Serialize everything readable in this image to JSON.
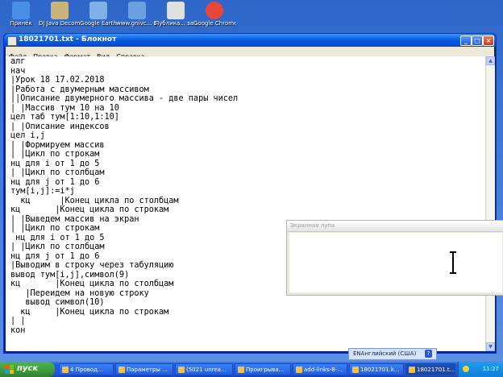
{
  "desktop_icons": [
    {
      "label": "Принёк",
      "color": "#4a8fe7"
    },
    {
      "label": "DJ Java Decompil",
      "color": "#c9b37a"
    },
    {
      "label": "Google Earth",
      "color": "#7fb0e8"
    },
    {
      "label": "www.gnivc... Браузер...",
      "color": "#6aa0e0"
    },
    {
      "label": "Публика... за 2011 го...",
      "color": "#e0e0e0"
    },
    {
      "label": "Google Chrome",
      "color": "#e9463a"
    }
  ],
  "window": {
    "title": "18021701.txt - Блокнот",
    "minimize": "_",
    "maximize": "□",
    "close": "×"
  },
  "menu": [
    "Файл",
    "Правка",
    "Формат",
    "Вид",
    "Справка"
  ],
  "code_lines": [
    "алг",
    "нач",
    "|Урок 18 17.02.2018",
    "|Работа с двумерным массивом",
    "||Описание двумерного массива - две пары чисел",
    "| |Массив тум 10 на 10",
    "цел таб тум[1:10,1:10]",
    "| |Описание индексов",
    "цел i,j",
    "| |Формируем массив",
    "| |Цикл по строкам",
    "нц для i от 1 до 5",
    "| |Цикл по столбцам",
    "нц для j от 1 до 6",
    "тум[i,j]:=i*j",
    "  кц      |Конец цикла по столбцам",
    "кц       |Конец цикла по строкам",
    "| |Выведем массив на экран",
    "| |Цикл по строкам",
    " нц для i от 1 до 5",
    "| |Цикл по столбцам",
    "нц для j от 1 до 6",
    "|Выводим в строку через табуляцию",
    "вывод тум[i,j],символ(9)",
    "кц       |Конец цикла по столбцам",
    "   |Переидем на новую строку",
    "   вывод символ(10)",
    "  кц     |Конец цикла по строкам",
    "| |",
    "кон"
  ],
  "magnifier": {
    "title": "Экранная лупа"
  },
  "language_bar": {
    "lang": "ENАнглийский (США)",
    "help": "?"
  },
  "taskbar": {
    "start_label": "пуск",
    "tasks": [
      {
        "label": "4 Провод...",
        "active": false
      },
      {
        "label": "Параметры ...",
        "active": false
      },
      {
        "label": "(5021 unrea...",
        "active": false
      },
      {
        "label": "Проигрыва...",
        "active": false
      },
      {
        "label": "add-links-8-...",
        "active": false
      },
      {
        "label": "18021701.k...",
        "active": false
      },
      {
        "label": "18021701.t...",
        "active": true
      }
    ],
    "clock": "11:27"
  }
}
